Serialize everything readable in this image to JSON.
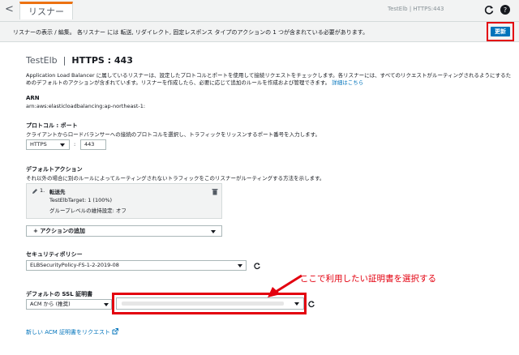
{
  "header": {
    "back_glyph": "<",
    "tab_label": "リスナー",
    "breadcrumb": "TestElb | HTTPS:443",
    "update_label": "更新"
  },
  "subheader": {
    "text": "リスナーの表示 / 編集。 各リスナー には 転送, リダイレクト, 固定レスポンス タイプのアクションの 1 つが含まれている必要があります。"
  },
  "listener": {
    "title_lb": "TestElb",
    "title_sep": "|",
    "title_port": "HTTPS : 443",
    "description": "Application Load Balancer に属しているリスナーは、設定したプロトコルとポートを使用して接続リクエストをチェックします。各リスナーには、すべてのリクエストがルーティングされるようにするためのデフォルトのアクションが含まれています。リスナーを作成したら、必要に応じて追加のルールを作成および管理できます。",
    "learn_more": "詳細はこちら",
    "arn_label": "ARN",
    "arn_value": "arn:aws:elasticloadbalancing:ap-northeast-1:"
  },
  "protocol": {
    "label": "プロトコル : ポート",
    "help": "クライアントからロードバランサーへの接続のプロトコルを選択し、トラフィックをリッスンするポート番号を入力します。",
    "protocol_value": "HTTPS",
    "separator": ":",
    "port_value": "443"
  },
  "default_action": {
    "label": "デフォルトアクション",
    "help": "それ以外の場合に別のルールによってルーティングされないトラフィックをこのリスナーがルーティングする方法を示します。",
    "item_number": "1.",
    "item_type": "転送先",
    "target": "TestElbTarget: 1 (100%)",
    "stickiness": "グループレベルの維持設定: オフ",
    "add_action": "アクションの追加"
  },
  "security_policy": {
    "label": "セキュリティポリシー",
    "value": "ELBSecurityPolicy-FS-1-2-2019-08"
  },
  "ssl_cert": {
    "label": "デフォルトの SSL 証明書",
    "source_value": "ACM から (推奨)",
    "cert_value": ""
  },
  "annotation": {
    "text": "ここで利用したい証明書を選択する"
  },
  "request_cert_link": "新しい ACM 証明書をリクエスト"
}
